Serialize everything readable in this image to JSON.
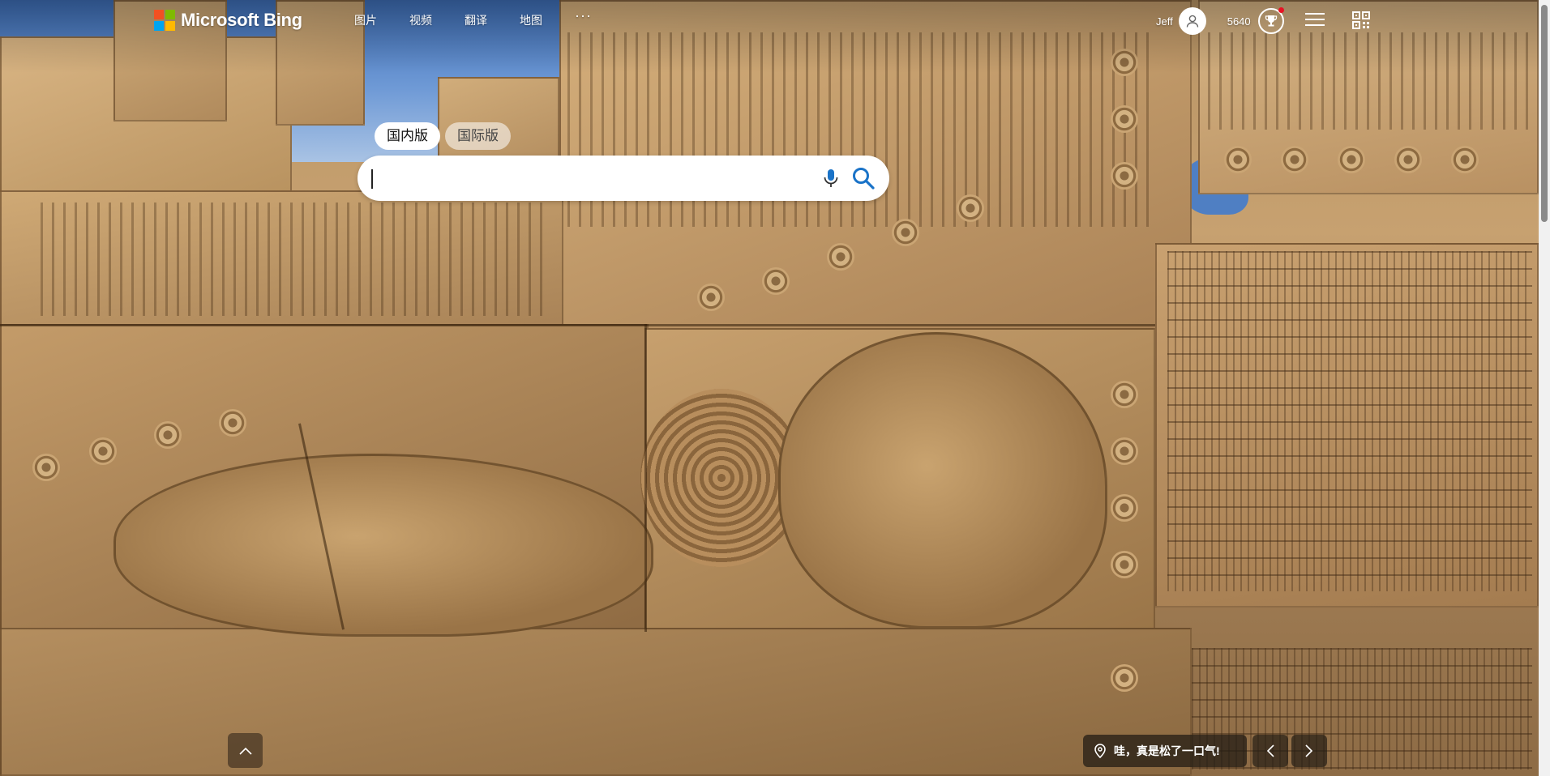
{
  "header": {
    "brand": "Microsoft Bing",
    "nav": [
      "图片",
      "视频",
      "翻译",
      "地图"
    ],
    "more": "···",
    "user_name": "Jeff",
    "points": "5640"
  },
  "search": {
    "tabs": [
      "国内版",
      "国际版"
    ],
    "active_tab": "国内版",
    "value": "",
    "placeholder": ""
  },
  "footer": {
    "caption": "哇，真是松了一口气!"
  },
  "colors": {
    "logo_red": "#f25022",
    "logo_green": "#7fba00",
    "logo_blue": "#00a4ef",
    "logo_yellow": "#ffb900",
    "search_icon": "#1a73c8"
  },
  "icons": [
    "microsoft-logo-icon",
    "user-icon",
    "trophy-icon",
    "hamburger-menu-icon",
    "qr-code-icon",
    "microphone-icon",
    "search-icon",
    "chevron-up-icon",
    "location-pin-icon",
    "chevron-left-icon",
    "chevron-right-icon"
  ]
}
